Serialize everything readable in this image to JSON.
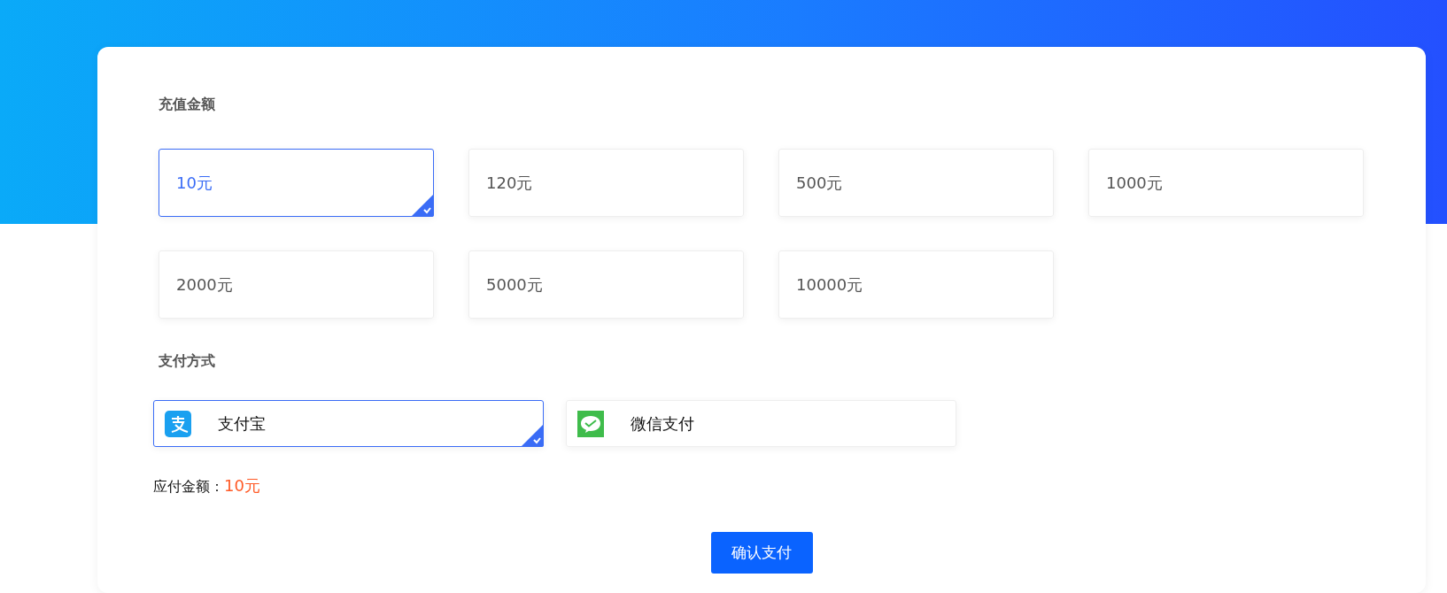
{
  "amount_section": {
    "title": "充值金额"
  },
  "amounts": [
    {
      "label": "10元",
      "selected": true
    },
    {
      "label": "120元",
      "selected": false
    },
    {
      "label": "500元",
      "selected": false
    },
    {
      "label": "1000元",
      "selected": false
    },
    {
      "label": "2000元",
      "selected": false
    },
    {
      "label": "5000元",
      "selected": false
    },
    {
      "label": "10000元",
      "selected": false
    }
  ],
  "payment_section": {
    "title": "支付方式"
  },
  "payment_methods": [
    {
      "kind": "alipay",
      "label": "支付宝",
      "selected": true
    },
    {
      "kind": "wechat",
      "label": "微信支付",
      "selected": false
    }
  ],
  "amount_due": {
    "label": "应付金额：",
    "value": "10元"
  },
  "confirm_button": "确认支付"
}
